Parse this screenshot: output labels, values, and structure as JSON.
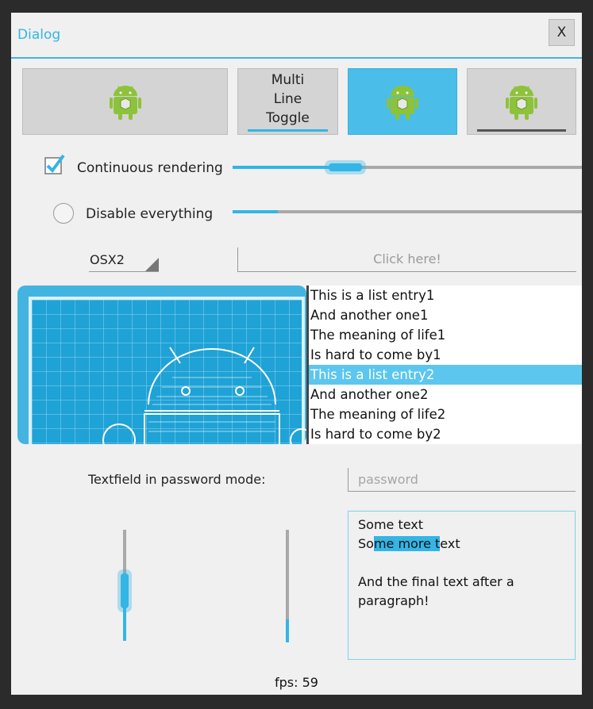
{
  "dialog": {
    "title": "Dialog",
    "close_label": "X"
  },
  "buttons": {
    "multi_line_toggle_lines": [
      "Multi",
      "Line",
      "Toggle"
    ]
  },
  "controls": {
    "continuous_rendering": {
      "label": "Continuous rendering",
      "checked": true,
      "slider_value": 0.28
    },
    "disable_everything": {
      "label": "Disable everything",
      "checked": false,
      "slider_value": 0.13
    }
  },
  "select": {
    "value": "OSX2"
  },
  "click_field": {
    "text": "Click here!"
  },
  "list": {
    "items": [
      "This is a list entry1",
      "And another one1",
      "The meaning of life1",
      "Is hard to come by1",
      "This is a list entry2",
      "And another one2",
      "The meaning of life2",
      "Is hard to come by2"
    ],
    "selected_index": 4
  },
  "password": {
    "label": "Textfield in password mode:",
    "placeholder": "password"
  },
  "vertical_sliders": {
    "left_value": 0.55,
    "right_value": 0.2
  },
  "textarea": {
    "line1": "Some text",
    "line2_pre": "So",
    "line2_sel": "me more t",
    "line2_post": "ext",
    "line3": "And the final text after a",
    "line4": "paragraph!"
  },
  "status": {
    "fps": "fps: 59"
  },
  "colors": {
    "accent": "#33b5e5",
    "dialog_bg": "#f0f0f0",
    "frame": "#2b2b2b"
  }
}
